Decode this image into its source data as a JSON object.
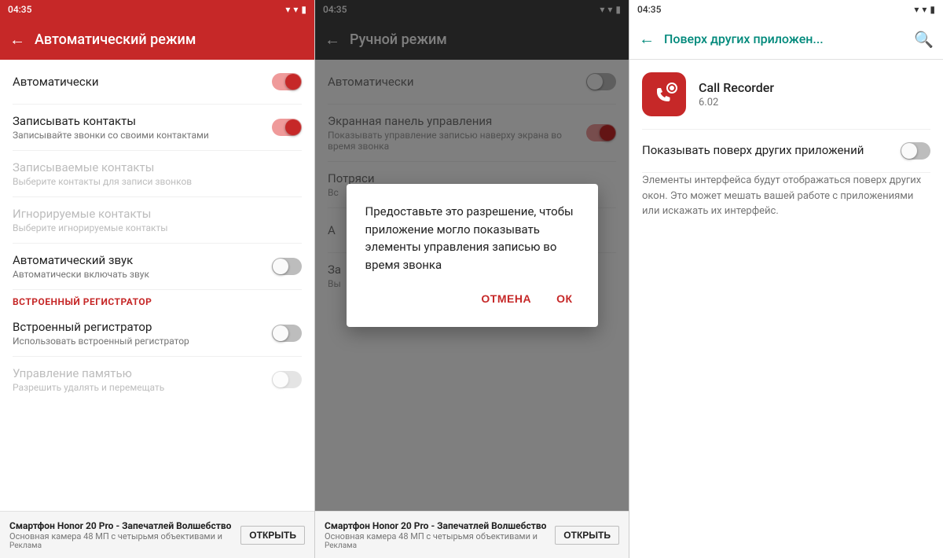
{
  "statusBar": {
    "time": "04:35"
  },
  "panel1": {
    "title": "Автоматический режим",
    "settings": [
      {
        "id": "auto",
        "title": "Автоматически",
        "subtitle": "",
        "toggleState": "on",
        "disabled": false
      },
      {
        "id": "record-contacts",
        "title": "Записывать контакты",
        "subtitle": "Записывайте звонки со своими контактами",
        "toggleState": "on",
        "disabled": false
      },
      {
        "id": "recorded-contacts",
        "title": "Записываемые контакты",
        "subtitle": "Выберите контакты для записи звонков",
        "toggleState": null,
        "disabled": true
      },
      {
        "id": "ignored-contacts",
        "title": "Игнорируемые контакты",
        "subtitle": "Выберите игнорируемые контакты",
        "toggleState": null,
        "disabled": true
      },
      {
        "id": "auto-sound",
        "title": "Автоматический звук",
        "subtitle": "Автоматически включать звук",
        "toggleState": "off",
        "disabled": false
      }
    ],
    "sectionHeader": "ВСТРОЕННЫЙ РЕГИСТРАТОР",
    "settingsAfterSection": [
      {
        "id": "builtin-recorder",
        "title": "Встроенный регистратор",
        "subtitle": "Использовать встроенный регистратор",
        "toggleState": "off",
        "disabled": false
      },
      {
        "id": "memory-management",
        "title": "Управление памятью",
        "subtitle": "Разрешить удалять и перемещать",
        "toggleState": "off",
        "disabled": true
      }
    ],
    "ad": {
      "title": "Смартфон Honor 20 Pro - Запечатлей Волшебство",
      "subtitle": "Основная камера 48 МП с четырьмя объективами и",
      "label": "Реклама",
      "openBtn": "ОТКРЫТЬ"
    }
  },
  "panel2": {
    "title": "Ручной режим",
    "settings": [
      {
        "id": "auto2",
        "title": "Автоматически",
        "subtitle": "",
        "toggleState": "off",
        "disabled": false
      },
      {
        "id": "screen-panel",
        "title": "Экранная панель управления",
        "subtitle": "Показывать управление записью наверху экрана во время звонка",
        "toggleState": "on",
        "disabled": false
      },
      {
        "id": "shake",
        "title": "Потряси",
        "subtitle": "Вс",
        "toggleState": null,
        "disabled": false
      },
      {
        "id": "shake-action",
        "title": "А",
        "subtitle": "",
        "toggleState": null,
        "disabled": false
      },
      {
        "id": "record-contacts2",
        "title": "За",
        "subtitle": "Вы",
        "toggleState": null,
        "disabled": false
      }
    ],
    "dialog": {
      "text": "Предоставьте это разрешение, чтобы приложение могло показывать элементы управления записью во время звонка",
      "cancelLabel": "ОТМЕНА",
      "okLabel": "ОК"
    },
    "ad": {
      "title": "Смартфон Honor 20 Pro - Запечатлей Волшебство",
      "subtitle": "Основная камера 48 МП с четырьмя объективами и",
      "label": "Реклама",
      "openBtn": "ОТКРЫТЬ"
    }
  },
  "panel3": {
    "title": "Поверх других приложен...",
    "app": {
      "name": "Call Recorder",
      "version": "6.02"
    },
    "permissionLabel": "Показывать поверх других приложений",
    "permissionDesc": "Элементы интерфейса будут отображаться поверх других окон. Это может мешать вашей работе с приложениями или искажать их интерфейс.",
    "toggleState": "off"
  }
}
